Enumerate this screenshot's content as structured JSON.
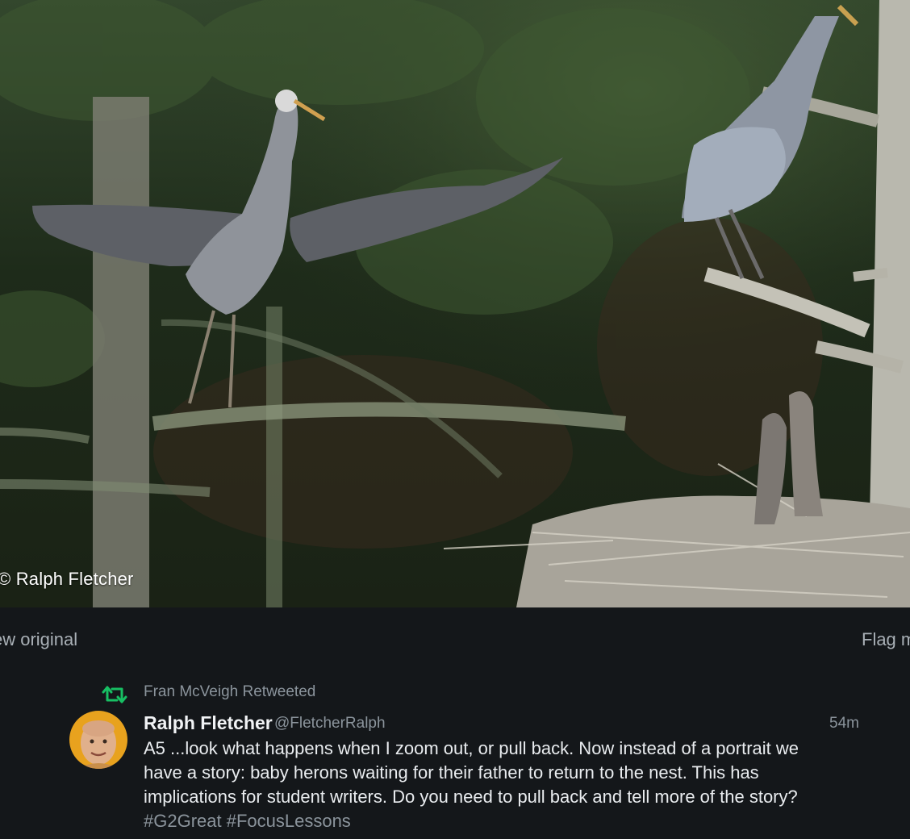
{
  "photo": {
    "watermark": "© Ralph Fletcher",
    "description_icon": "heron-nest-photo"
  },
  "actions": {
    "view_original": "ew original",
    "flag_media": "Flag m"
  },
  "tweet": {
    "retweet_label": "Fran McVeigh Retweeted",
    "retweet_icon": "retweet-icon",
    "author_name": "Ralph Fletcher",
    "author_handle": "@FletcherRalph",
    "timestamp": "54m",
    "text_lines": [
      "A5 ...look what happens when I zoom out, or pull back. Now instead of a portrait we",
      "have a story: baby herons waiting for their father to return to the nest. This has",
      "implications for student writers. Do you need to pull back and tell more of the story?"
    ],
    "hashtags": "#G2Great #FocusLessons"
  },
  "colors": {
    "background": "#14171a",
    "retweet_green": "#17bf63",
    "muted_text": "#8b949c",
    "primary_text": "#e9ecef"
  }
}
